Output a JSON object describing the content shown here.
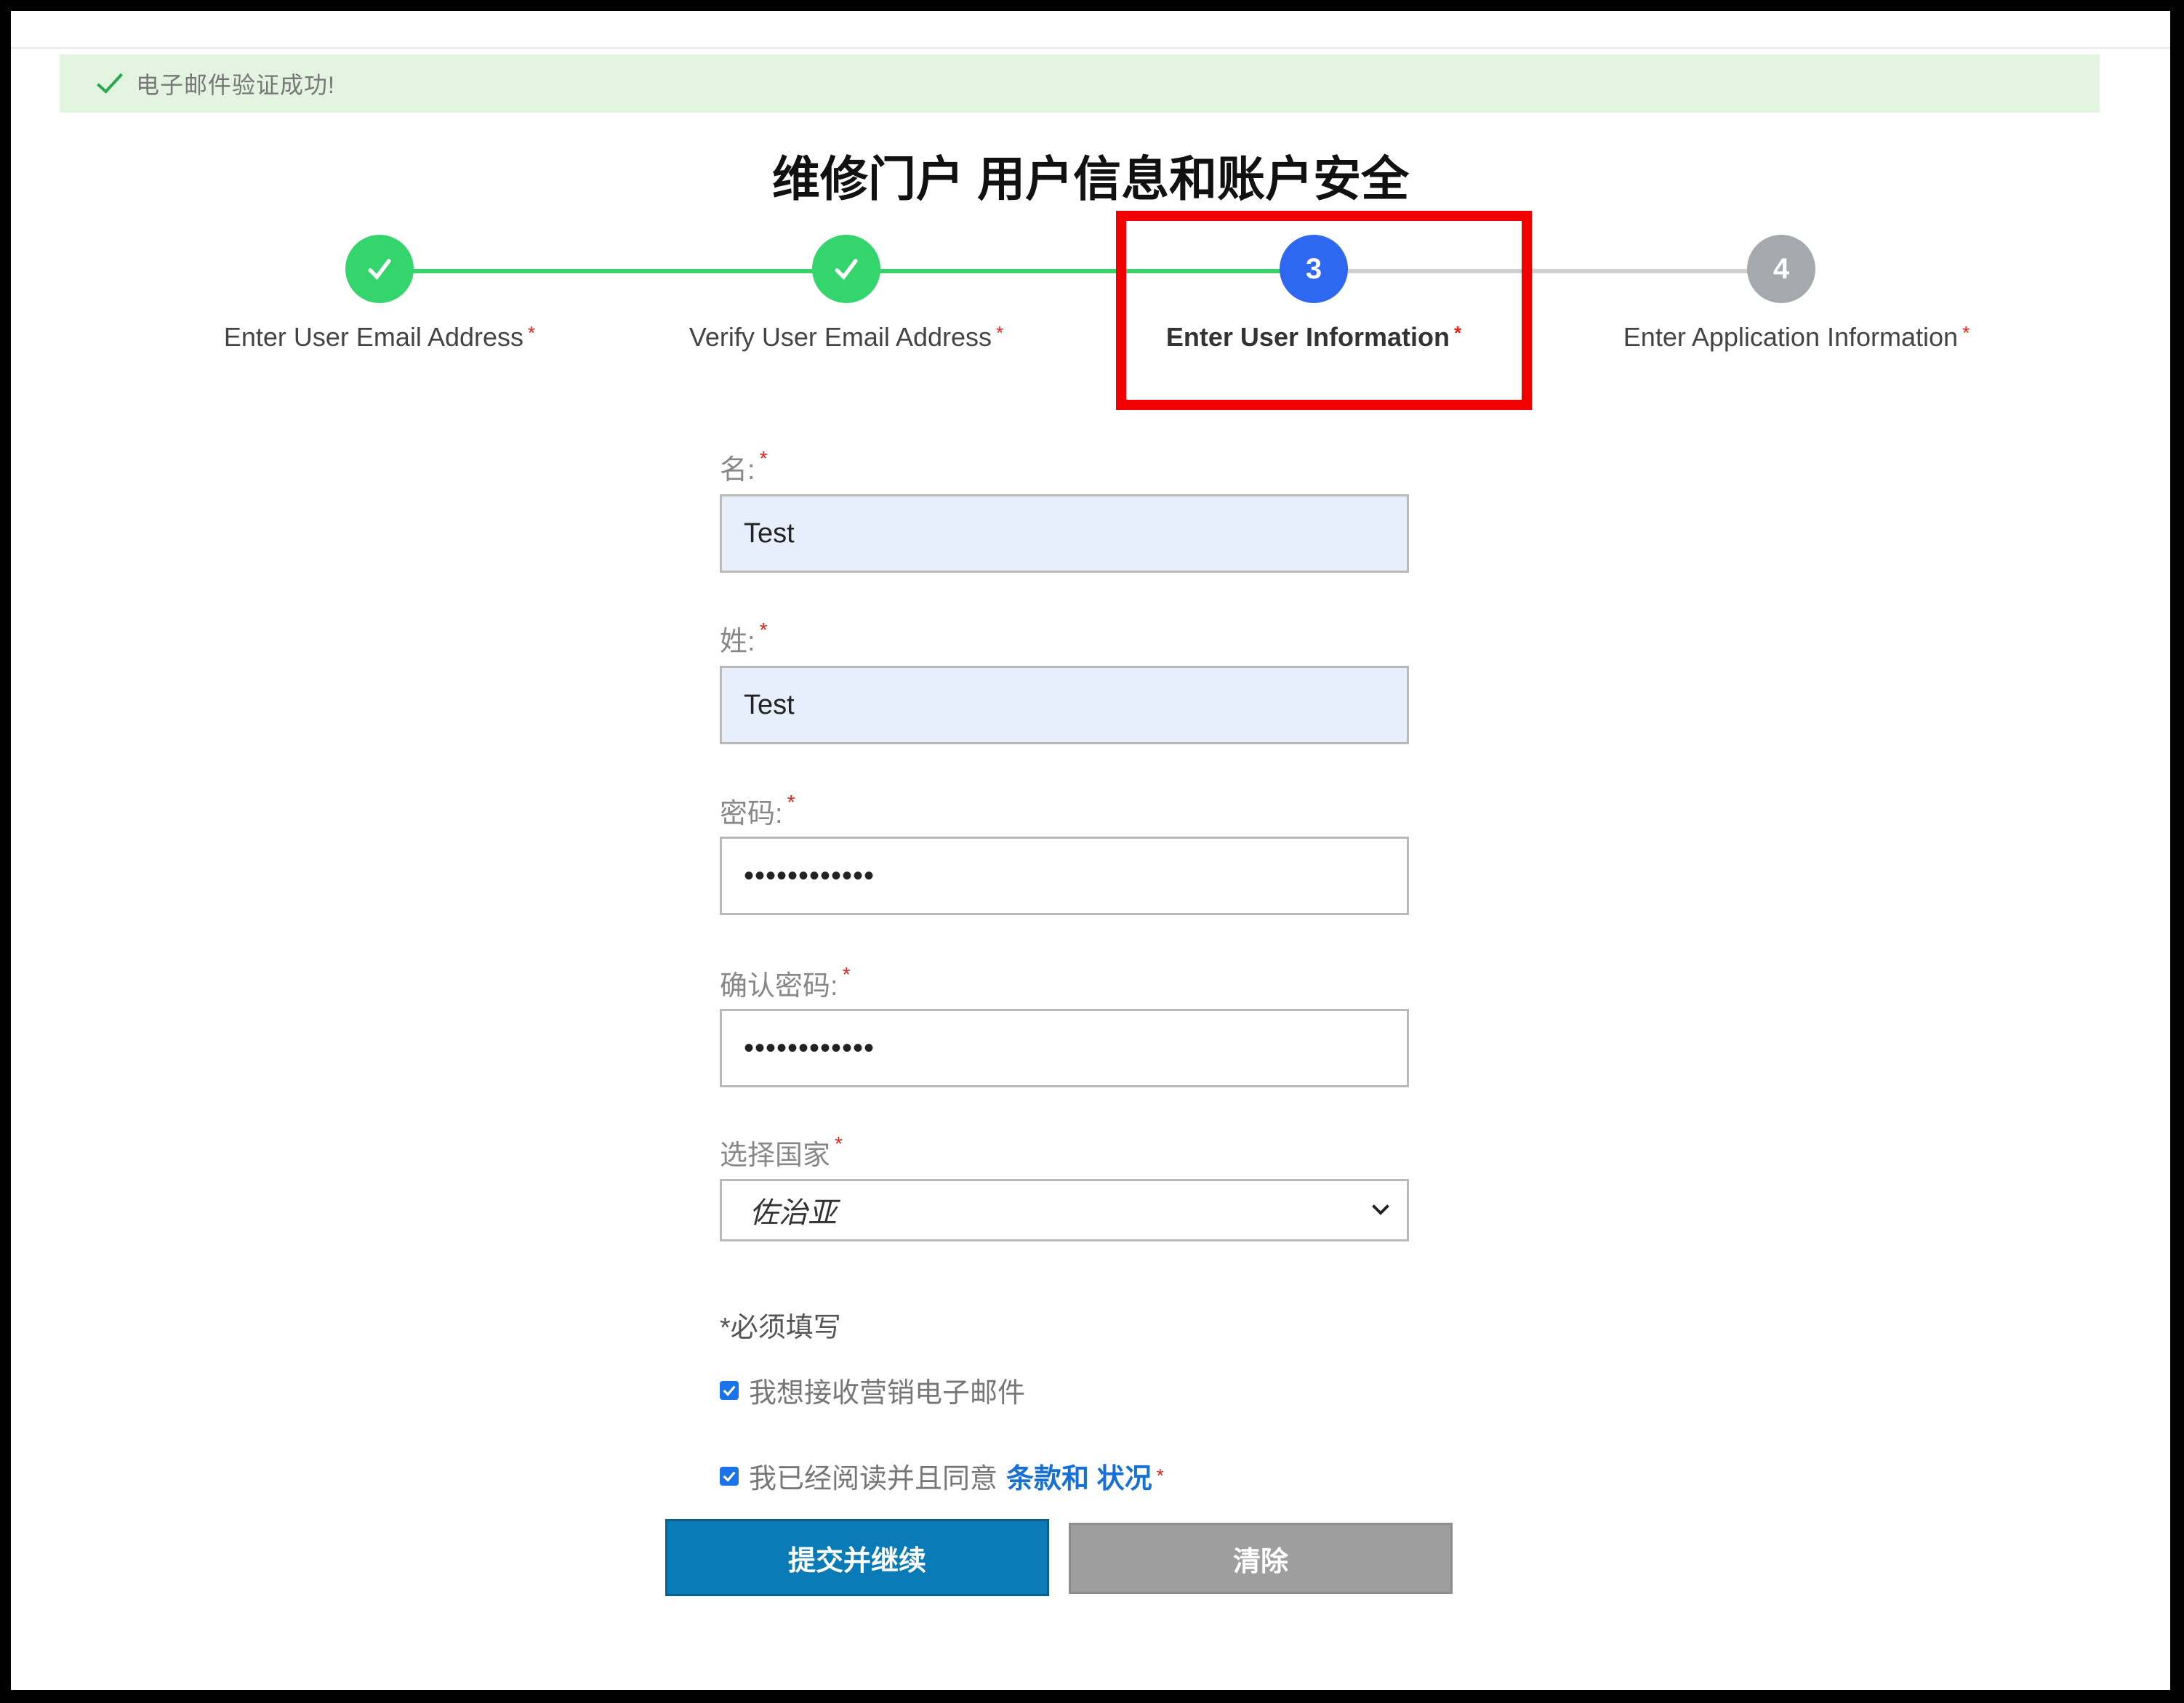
{
  "alert": {
    "message": "电子邮件验证成功!",
    "color": "#e3f5e1"
  },
  "page_title": "维修门户 用户信息和账户安全",
  "stepper": {
    "steps": [
      {
        "label": "Enter User Email Address",
        "status": "complete",
        "icon": "check-icon"
      },
      {
        "label": "Verify User Email Address",
        "status": "complete",
        "icon": "check-icon"
      },
      {
        "label": "Enter User Information",
        "number": "3",
        "status": "active"
      },
      {
        "label": "Enter Application Information",
        "number": "4",
        "status": "pending"
      }
    ],
    "required_mark": "*",
    "colors": {
      "complete": "#33d56c",
      "active": "#2f68f0",
      "pending": "#a5a9ad"
    }
  },
  "form": {
    "first_name": {
      "label": "名:",
      "value": "Test"
    },
    "last_name": {
      "label": "姓:",
      "value": "Test"
    },
    "password": {
      "label": "密码:",
      "value": "••••••••••••"
    },
    "confirm_password": {
      "label": "确认密码:",
      "value": "••••••••••••"
    },
    "country": {
      "label": "选择国家",
      "value": "佐治亚"
    },
    "required_note": "*必须填写",
    "marketing_checkbox": {
      "label": "我想接收营销电子邮件",
      "checked": true
    },
    "terms_checkbox": {
      "label": "我已经阅读并且同意",
      "link": "条款和 状况",
      "checked": true
    }
  },
  "buttons": {
    "submit": "提交并继续",
    "clear": "清除"
  }
}
